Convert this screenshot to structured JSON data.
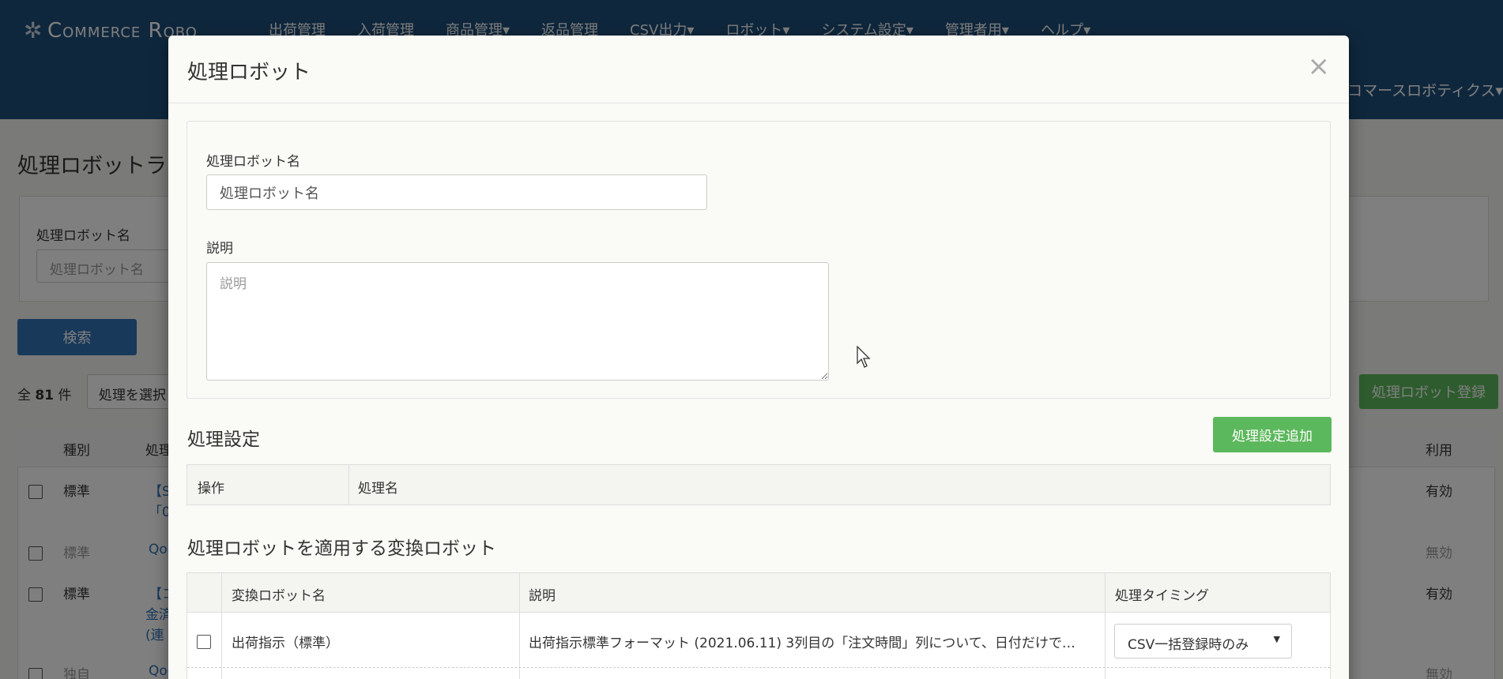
{
  "app": {
    "logo": "Commerce Robo",
    "nav": [
      "出荷管理",
      "入荷管理",
      "商品管理▾",
      "返品管理",
      "CSV出力▾",
      "ロボット▾",
      "システム設定▾",
      "管理者用▾",
      "ヘルプ▾"
    ],
    "user_menu": "コマースロボティクス▾"
  },
  "background": {
    "page_title": "処理ロボットラ",
    "search_label": "処理ロボット名",
    "search_placeholder": "処理ロボット名",
    "search_button": "検索",
    "count_prefix": "全",
    "count_value": "81",
    "count_suffix": "件",
    "bulk_select": "処理を選択",
    "register_button": "処理ロボット登録",
    "table_headers": [
      "種別",
      "処理",
      "利用"
    ],
    "rows": [
      {
        "type": "標準",
        "name": "【S",
        "name2": "「0",
        "status": "有効"
      },
      {
        "type": "標準",
        "name": "Qoo",
        "status": "無効"
      },
      {
        "type": "標準",
        "name": "【コ",
        "name2": "金済",
        "name3": "(連",
        "status": "有効"
      },
      {
        "type": "独自",
        "name": "Qoo",
        "status": "無効"
      }
    ]
  },
  "modal": {
    "title": "処理ロボット",
    "close_symbol": "×",
    "name_label": "処理ロボット名",
    "name_value": "処理ロボット名",
    "desc_label": "説明",
    "desc_placeholder": "説明",
    "process_section_title": "処理設定",
    "add_process_button": "処理設定追加",
    "process_headers": [
      "操作",
      "処理名"
    ],
    "conv_section_title": "処理ロボットを適用する変換ロボット",
    "conv_headers": [
      "変換ロボット名",
      "説明",
      "処理タイミング"
    ],
    "conv_rows": [
      {
        "name": "出荷指示（標準）",
        "description": "出荷指示標準フォーマット (2021.06.11) 3列目の「注文時間」列について、日付だけで…",
        "timing": "CSV一括登録時のみ"
      }
    ]
  }
}
